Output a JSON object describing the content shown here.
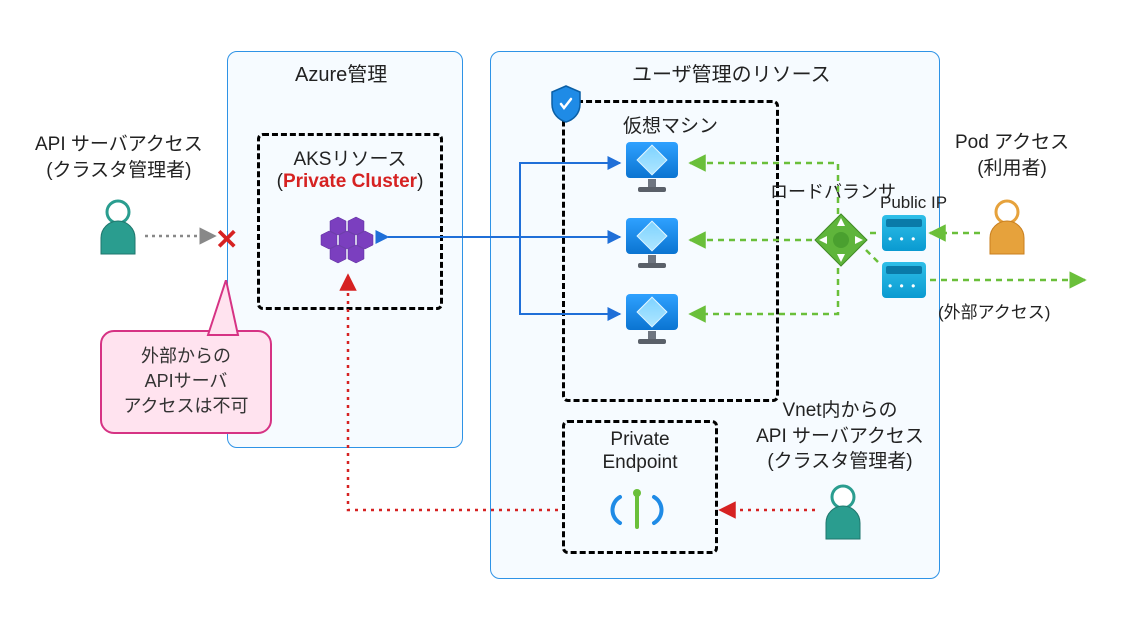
{
  "azureBox": {
    "title": "Azure管理"
  },
  "userResBox": {
    "title": "ユーザ管理のリソース"
  },
  "aksBox": {
    "label_line1": "AKSリソース",
    "label_line2_pre": "(",
    "label_line2_core": "Private Cluster",
    "label_line2_post": ")"
  },
  "vmBox": {
    "title": "仮想マシン"
  },
  "peBox": {
    "line1": "Private",
    "line2": "Endpoint"
  },
  "callout": {
    "line1": "外部からの",
    "line2": "APIサーバ",
    "line3": "アクセスは不可"
  },
  "extAdmin": {
    "line1": "API サーバアクセス",
    "line2": "(クラスタ管理者)"
  },
  "loadBalancer": {
    "label": "ロードバランサ"
  },
  "publicIp": {
    "label": "Public IP"
  },
  "podUser": {
    "line1": "Pod アクセス",
    "line2": "(利用者)"
  },
  "extAccess": {
    "label": "(外部アクセス)"
  },
  "vnetAdmin": {
    "line1": "Vnet内からの",
    "line2": "API サーバアクセス",
    "line3": "(クラスタ管理者)"
  },
  "colors": {
    "blueLine": "#1f6fd8",
    "greenLine": "#6abf3a",
    "redLine": "#d62222",
    "grayLine": "#888"
  }
}
